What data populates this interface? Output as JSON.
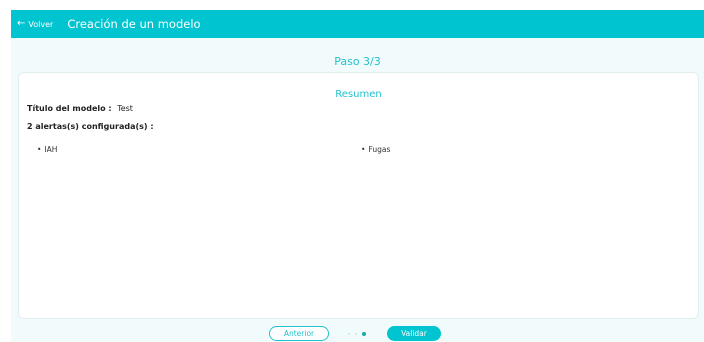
{
  "header": {
    "back_label": "Volver",
    "title": "Creación de un modelo"
  },
  "step_label": "Paso 3/3",
  "summary": {
    "title": "Resumen",
    "model_title_label": "Título del modelo :",
    "model_title_value": "Test",
    "alerts_heading": "2 alertas(s) configurada(s) :",
    "alerts": [
      "IAH",
      "Fugas"
    ]
  },
  "footer": {
    "prev_label": "Anterior",
    "validate_label": "Validar",
    "steps_total": 3,
    "current_step": 3
  },
  "colors": {
    "accent": "#00c4cf",
    "background": "#f1fbfc"
  }
}
